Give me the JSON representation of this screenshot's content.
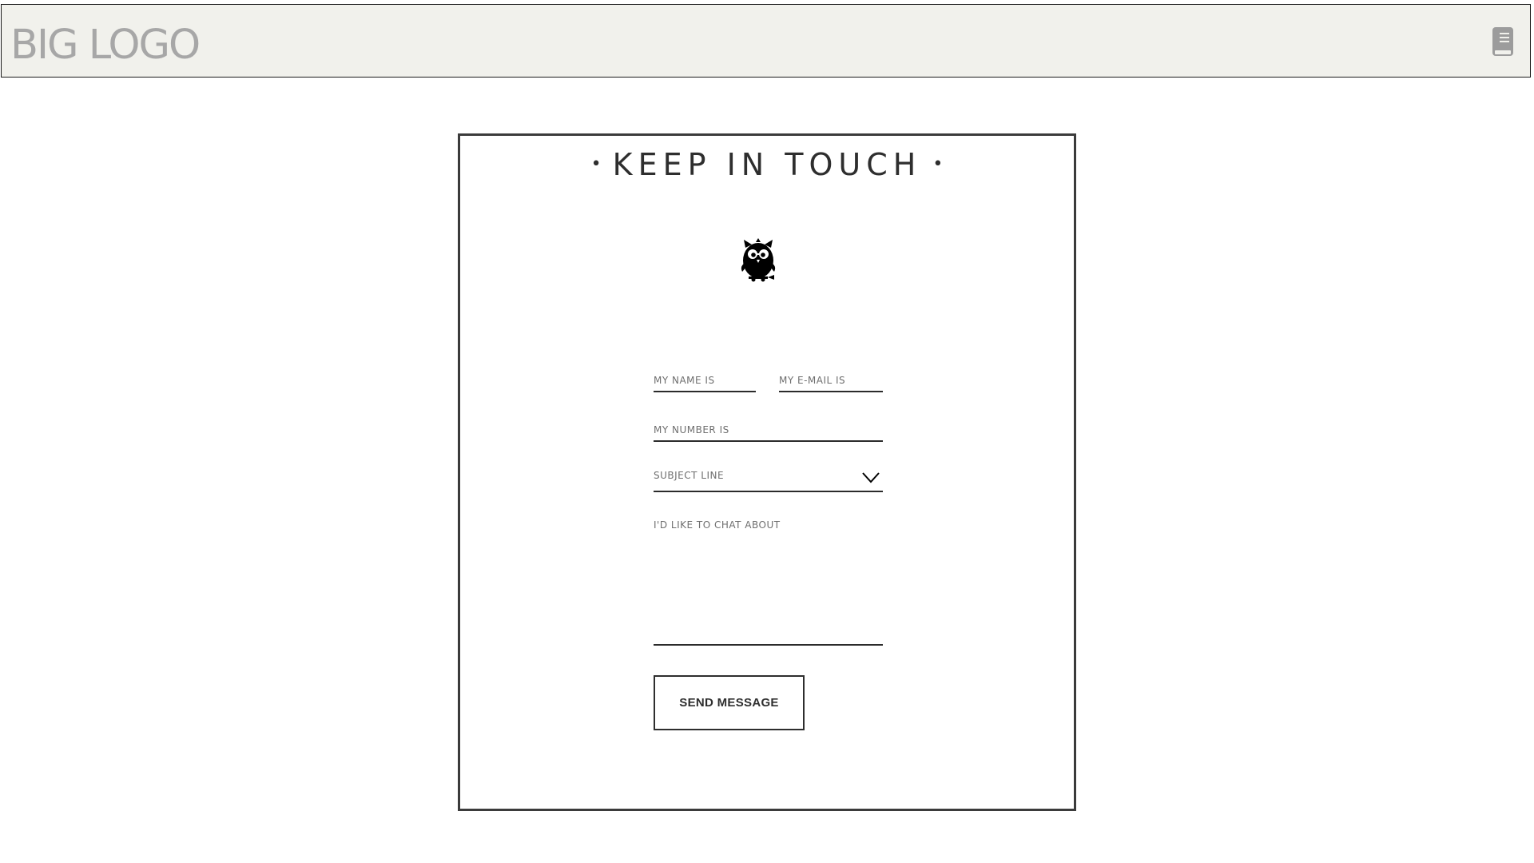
{
  "header": {
    "logo_text": "BIG LOGO",
    "background_color": "#f1f1ec",
    "logo_color": "#a7a7a7",
    "menu_icon": "book-icon"
  },
  "contact": {
    "title": "KEEP IN TOUCH",
    "title_dot": "•",
    "mascot_icon": "owl-icon",
    "name_placeholder": "MY NAME IS",
    "email_placeholder": "MY E-MAIL IS",
    "number_placeholder": "MY NUMBER IS",
    "subject_label": "SUBJECT LINE",
    "message_placeholder": "I'D LIKE TO CHAT ABOUT",
    "send_label": "SEND MESSAGE"
  }
}
